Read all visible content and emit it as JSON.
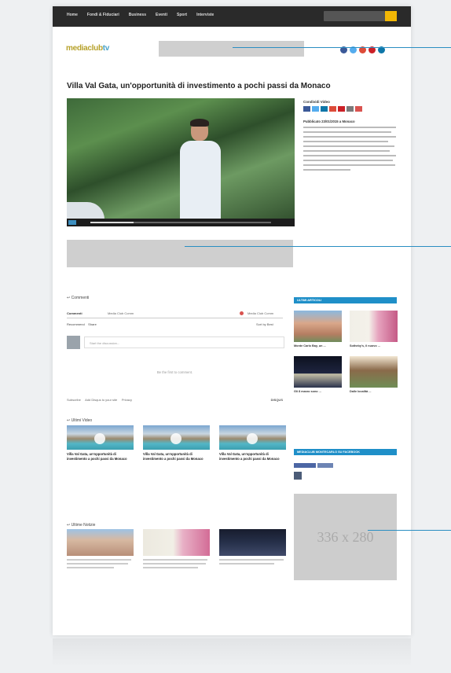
{
  "site": {
    "logo_main": "mediaclub",
    "logo_accent": "tv",
    "nav_items": [
      "Home",
      "Fondi & Fiduciari",
      "Business",
      "Eventi",
      "Sport",
      "Interviste"
    ]
  },
  "social_colors": [
    "#3b5998",
    "#55acee",
    "#dd4b39",
    "#cb2027",
    "#0e76a8"
  ],
  "article": {
    "title": "Villa Val Gata, un'opportunità di investimento a pochi passi da Monaco",
    "share_label": "Condividi Video",
    "published_label": "Pubblicato 23/01/2015 a Monaco"
  },
  "share_colors": [
    "#3b5998",
    "#55acee",
    "#0e76a8",
    "#dd4b39",
    "#cb2027",
    "#7a7a7a",
    "#d9534f"
  ],
  "comments": {
    "section_title": "Commenti",
    "tab_main": "Commenti",
    "tab_community": "Media Club Comm",
    "login_label": "Media Club Comm",
    "recommend_label": "Recommend",
    "share_label": "Share",
    "sort_label": "Sort by Best",
    "input_placeholder": "Start the discussion...",
    "empty_text": "Be the first to comment.",
    "subscribe_label": "Subscribe",
    "add_disqus_label": "Add Disqus to your site",
    "privacy_label": "Privacy",
    "disqus_brand": "DISQUS"
  },
  "latest_videos": {
    "title": "Ultimi Video",
    "items": [
      {
        "caption": "Villa Val Gata, un'opportunità di investimento a pochi passi da Monaco"
      },
      {
        "caption": "Villa Val Gata, un'opportunità di investimento a pochi passi da Monaco"
      },
      {
        "caption": "Villa Val Gata, un'opportunità di investimento a pochi passi da Monaco"
      }
    ]
  },
  "latest_news": {
    "title": "Ultime Notizie"
  },
  "sidebar": {
    "latest_articles_title": "ULTIMI ARTICOLI",
    "facebook_title": "MEDIACLUB MONTECARLO SU FACEBOOK",
    "articles": [
      {
        "caption": "Monte Carlo Bay, un ..."
      },
      {
        "caption": "Sotheby's, il nuovo ..."
      },
      {
        "caption": "Gli 8 marzo sono ..."
      },
      {
        "caption": "Dalle località ..."
      }
    ]
  },
  "ads": {
    "rectangle_label": "336 x 280"
  },
  "accent_color": "#1f8fc8"
}
